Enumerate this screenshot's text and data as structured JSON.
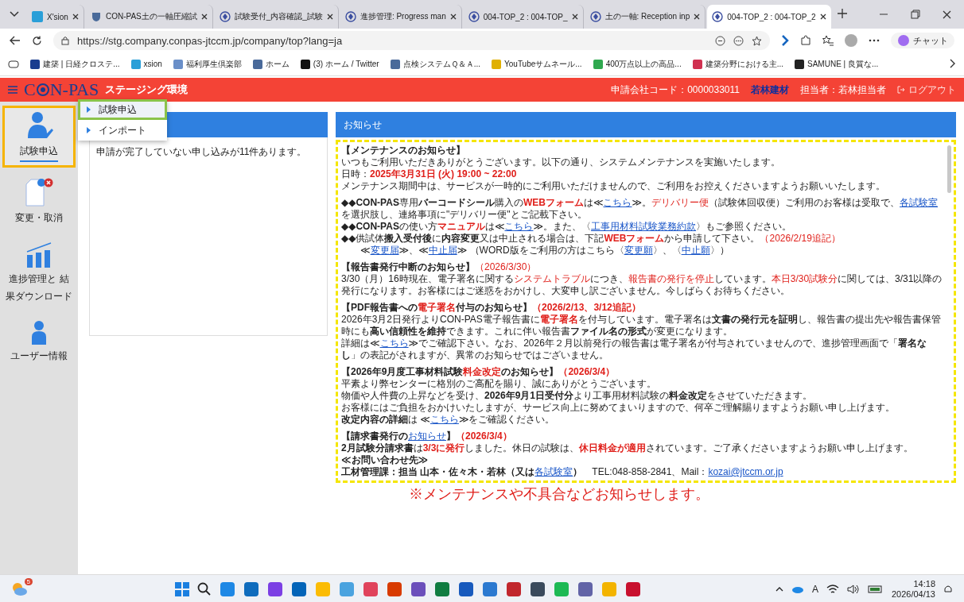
{
  "browser": {
    "tabs": [
      {
        "title": "X'sion",
        "selected": false
      },
      {
        "title": "CON-PAS土の一軸圧縮試",
        "selected": false
      },
      {
        "title": "試験受付_内容確認_試験",
        "selected": false
      },
      {
        "title": "進捗管理: Progress man",
        "selected": false
      },
      {
        "title": "004-TOP_2 : 004-TOP_",
        "selected": false
      },
      {
        "title": "土の一軸: Reception inp",
        "selected": false
      },
      {
        "title": "004-TOP_2 : 004-TOP_2",
        "selected": true
      }
    ],
    "address": "https://stg.company.conpas-jtccm.jp/company/top?lang=ja",
    "copilot_label": "チャット",
    "bookmarks": [
      "建築 | 日経クロステ...",
      "xsion",
      "福利厚生倶楽部",
      "ホーム",
      "(3) ホーム / Twitter",
      "点検システムＱ＆Ａ...",
      "YouTubeサムネール...",
      "400万点以上の高品...",
      "建築分野における主...",
      "SAMUNE | 良質な..."
    ]
  },
  "app": {
    "logo_left": "C",
    "logo_right": "N-PAS",
    "environment": "ステージング環境",
    "company_code": "申請会社コード：0000033011",
    "company_name": "若林建材",
    "user": "担当者：若林担当者",
    "logout": "ログアウト"
  },
  "sidebar": [
    {
      "label": "試験申込",
      "kind": "person",
      "selected": true
    },
    {
      "label": "変更・取消",
      "kind": "document",
      "selected": false
    },
    {
      "label": "進捗管理と 結果ダウンロード",
      "kind": "chart",
      "selected": false
    },
    {
      "label": "ユーザー情報",
      "kind": "user",
      "selected": false
    }
  ],
  "menu": [
    {
      "label": "試験申込",
      "selected": true
    },
    {
      "label": "インポート",
      "selected": false
    }
  ],
  "applications_panel": {
    "message": "申請が完了していない申し込みが11件あります。"
  },
  "notice_panel": {
    "title": "お知らせ",
    "blocks": [
      [
        [
          {
            "kind": "b",
            "text": "【メンテナンスのお知らせ】"
          }
        ],
        [
          {
            "kind": "t",
            "text": "いつもご利用いただきありがとうございます。以下の通り、システムメンテナンスを実施いたします。"
          }
        ],
        [
          {
            "kind": "t",
            "text": "日時："
          },
          {
            "kind": "rb",
            "text": "2025年3月31日 (火) 19:00 ~ 22:00"
          }
        ],
        [
          {
            "kind": "t",
            "text": "メンテナンス期間中は、サービスが一時的にご利用いただけませんので、ご利用をお控えくださいますようお願いいたします。"
          }
        ]
      ],
      [
        [
          {
            "kind": "b",
            "text": "◆◆CON-PAS"
          },
          {
            "kind": "t",
            "text": "専用"
          },
          {
            "kind": "b",
            "text": "バーコードシール"
          },
          {
            "kind": "t",
            "text": "購入の"
          },
          {
            "kind": "rb",
            "text": "WEBフォーム"
          },
          {
            "kind": "t",
            "text": "は≪"
          },
          {
            "kind": "a",
            "text": "こちら"
          },
          {
            "kind": "t",
            "text": "≫。"
          },
          {
            "kind": "r",
            "text": "デリバリー便"
          },
          {
            "kind": "t",
            "text": "（試験体回収便）ご利用のお客様は受取で、"
          },
          {
            "kind": "a",
            "text": "各試験室"
          },
          {
            "kind": "t",
            "text": "を選択肢し、連絡事項に\"デリバリー便\"とご記載下さい。"
          }
        ],
        [
          {
            "kind": "b",
            "text": "◆◆CON-PAS"
          },
          {
            "kind": "t",
            "text": "の使い方"
          },
          {
            "kind": "rb",
            "text": "マニュアル"
          },
          {
            "kind": "t",
            "text": "は≪"
          },
          {
            "kind": "a",
            "text": "こちら"
          },
          {
            "kind": "t",
            "text": "≫。また、〈"
          },
          {
            "kind": "a",
            "text": "工事用材料試験業務約款"
          },
          {
            "kind": "t",
            "text": "〉もご参照ください。"
          }
        ],
        [
          {
            "kind": "b",
            "text": "◆◆"
          },
          {
            "kind": "t",
            "text": "供試体"
          },
          {
            "kind": "b",
            "text": "搬入受付後"
          },
          {
            "kind": "t",
            "text": "に"
          },
          {
            "kind": "b",
            "text": "内容変更"
          },
          {
            "kind": "t",
            "text": "又は中止される場合は、下記"
          },
          {
            "kind": "rb",
            "text": "WEBフォーム"
          },
          {
            "kind": "t",
            "text": "から申請して下さい。"
          },
          {
            "kind": "r",
            "text": "（2026/2/19追記）"
          }
        ],
        [
          {
            "kind": "t",
            "text": "　　≪"
          },
          {
            "kind": "a",
            "text": "変更届"
          },
          {
            "kind": "t",
            "text": "≫、≪"
          },
          {
            "kind": "a",
            "text": "中止届"
          },
          {
            "kind": "t",
            "text": "≫ （WORD版をご利用の方はこちら〈"
          },
          {
            "kind": "a",
            "text": "変更願"
          },
          {
            "kind": "t",
            "text": "〉、〈"
          },
          {
            "kind": "a",
            "text": "中止願"
          },
          {
            "kind": "t",
            "text": "〉）"
          }
        ]
      ],
      [
        [
          {
            "kind": "b",
            "text": "【報告書発行中断のお知らせ】"
          },
          {
            "kind": "r",
            "text": "（2026/3/30）"
          }
        ],
        [
          {
            "kind": "t",
            "text": "3/30（月）16時現在、電子署名に関する"
          },
          {
            "kind": "r",
            "text": "システムトラブル"
          },
          {
            "kind": "t",
            "text": "につき、"
          },
          {
            "kind": "r",
            "text": "報告書の発行を停止"
          },
          {
            "kind": "t",
            "text": "しています。"
          },
          {
            "kind": "r",
            "text": "本日3/30試験分"
          },
          {
            "kind": "t",
            "text": "に関しては、3/31以降の発行になります。お客様にはご迷惑をおかけし、大変申し訳ございません。今しばらくお待ちください。"
          }
        ]
      ],
      [
        [
          {
            "kind": "b",
            "text": "【PDF報告書への"
          },
          {
            "kind": "rb",
            "text": "電子署名"
          },
          {
            "kind": "b",
            "text": "付与のお知らせ】"
          },
          {
            "kind": "rb",
            "text": "（2026/2/13、3/12追記）"
          }
        ],
        [
          {
            "kind": "t",
            "text": "2026年3月2日発行よりCON-PAS電子報告書に"
          },
          {
            "kind": "rb",
            "text": "電子署名"
          },
          {
            "kind": "t",
            "text": "を付与しています。電子署名は"
          },
          {
            "kind": "b",
            "text": "文書の発行元を証明"
          },
          {
            "kind": "t",
            "text": "し、報告書の提出先や報告書保管時にも"
          },
          {
            "kind": "b",
            "text": "高い信頼性を維持"
          },
          {
            "kind": "t",
            "text": "できます。これに伴い報告書"
          },
          {
            "kind": "b",
            "text": "ファイル名の形式"
          },
          {
            "kind": "t",
            "text": "が変更になります。"
          }
        ],
        [
          {
            "kind": "t",
            "text": "詳細は≪"
          },
          {
            "kind": "a",
            "text": "こちら"
          },
          {
            "kind": "t",
            "text": "≫でご確認下さい。なお、2026年２月以前発行の報告書は電子署名が付与されていませんので、進捗管理画面で「"
          },
          {
            "kind": "b",
            "text": "署名なし"
          },
          {
            "kind": "t",
            "text": "」の表記がされますが、異常のお知らせではございません。"
          }
        ]
      ],
      [
        [
          {
            "kind": "b",
            "text": "【2026年9月度工事材料試験"
          },
          {
            "kind": "rb",
            "text": "料金改定"
          },
          {
            "kind": "b",
            "text": "のお知らせ】"
          },
          {
            "kind": "rb",
            "text": "（2026/3/4）"
          }
        ],
        [
          {
            "kind": "t",
            "text": "平素より弊センターに格別のご高配を賜り、誠にありがとうございます。"
          }
        ],
        [
          {
            "kind": "t",
            "text": "物価や人件費の上昇などを受け、"
          },
          {
            "kind": "b",
            "text": "2026年9月1日受付分"
          },
          {
            "kind": "t",
            "text": "より工事用材料試験の"
          },
          {
            "kind": "b",
            "text": "料金改定"
          },
          {
            "kind": "t",
            "text": "をさせていただきます。"
          }
        ],
        [
          {
            "kind": "t",
            "text": "お客様にはご負担をおかけいたしますが、サービス向上に努めてまいりますので、何卒ご理解賜りますようお願い申し上げます。"
          }
        ],
        [
          {
            "kind": "b",
            "text": "改定内容の詳細"
          },
          {
            "kind": "t",
            "text": "は ≪"
          },
          {
            "kind": "a",
            "text": "こちら"
          },
          {
            "kind": "t",
            "text": "≫をご確認ください。"
          }
        ]
      ],
      [
        [
          {
            "kind": "b",
            "text": "【請求書発行の"
          },
          {
            "kind": "a",
            "text": "お知らせ"
          },
          {
            "kind": "b",
            "text": "】"
          },
          {
            "kind": "rb",
            "text": "（2026/3/4）"
          }
        ],
        [
          {
            "kind": "b",
            "text": "2月試験分請求書"
          },
          {
            "kind": "t",
            "text": "は"
          },
          {
            "kind": "rb",
            "text": "3/3に発行"
          },
          {
            "kind": "t",
            "text": "しました。休日の試験は、"
          },
          {
            "kind": "rb",
            "text": "休日料金が適用"
          },
          {
            "kind": "t",
            "text": "されています。ご了承くださいますようお願い申し上げます。"
          }
        ],
        [
          {
            "kind": "b",
            "text": "≪お問い合わせ先≫"
          }
        ],
        [
          {
            "kind": "b",
            "text": "工材管理課：担当 山本・佐々木・若林（又は"
          },
          {
            "kind": "a",
            "text": "各試験室"
          },
          {
            "kind": "b",
            "text": "）"
          },
          {
            "kind": "t",
            "text": "　TEL:048-858-2841、Mail："
          },
          {
            "kind": "a",
            "text": "kozai@jtccm.or.jp"
          }
        ]
      ]
    ]
  },
  "annotation": "※メンテナンスや不具合などお知らせします。",
  "taskbar": {
    "weather_badge": "5",
    "input_indicator": "A",
    "time": "14:18",
    "date": "2026/04/13"
  }
}
